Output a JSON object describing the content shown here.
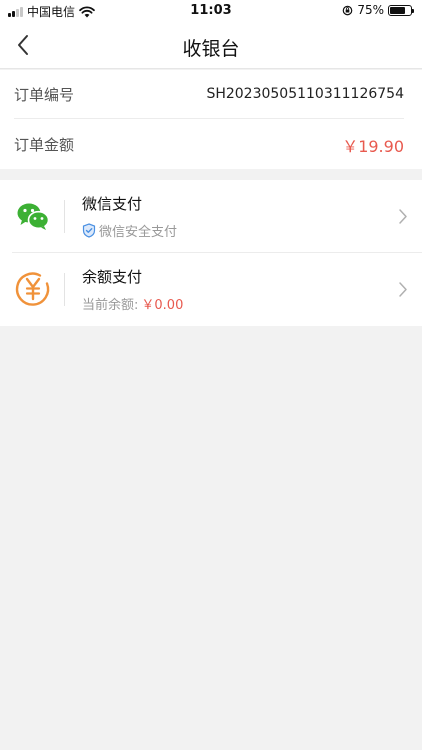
{
  "status_bar": {
    "carrier": "中国电信",
    "time": "11:03",
    "battery": "75%",
    "battery_level": 0.75
  },
  "nav": {
    "title": "收银台",
    "back_icon": "chevron-left-icon"
  },
  "order": {
    "number_label": "订单编号",
    "number_value": "SH20230505110311126754",
    "amount_label": "订单金额",
    "amount_value": "￥19.90"
  },
  "payment_methods": [
    {
      "name": "微信支付",
      "sub_text": "微信安全支付",
      "icon": "wechat-icon",
      "badge_icon": "shield-icon"
    },
    {
      "name": "余额支付",
      "sub_label": "当前余额:",
      "sub_value": "￥0.00",
      "icon": "yen-coin-icon"
    }
  ],
  "colors": {
    "accent_red": "#e85a4f",
    "wechat_green": "#3cb034",
    "balance_orange": "#f0923a",
    "shield_blue": "#4a90e2",
    "page_bg": "#f2f2f2"
  }
}
